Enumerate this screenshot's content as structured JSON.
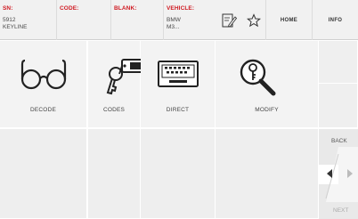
{
  "header": {
    "sn_label": "SN:",
    "sn_value": "5912",
    "sn_subvalue": "KEYLINE",
    "code_label": "CODE:",
    "blank_label": "BLANK:",
    "vehicle_label": "VEHICLE:",
    "vehicle_make": "BMW",
    "vehicle_model": "M3...",
    "home_label": "HOME",
    "info_label": "INFO"
  },
  "tiles": [
    {
      "label": "DECODE",
      "icon": "glasses-icon"
    },
    {
      "label": "CODES",
      "icon": "key-tag-icon"
    },
    {
      "label": "DIRECT",
      "icon": "keyboard-icon"
    },
    {
      "label": "MODIFY",
      "icon": "magnifier-key-icon"
    }
  ],
  "nav": {
    "back_label": "BACK",
    "next_label": "NEXT"
  },
  "colors": {
    "accent": "#d01a22",
    "tile_bg": "#f3f3f3",
    "header_bg": "#f1f1f1"
  }
}
